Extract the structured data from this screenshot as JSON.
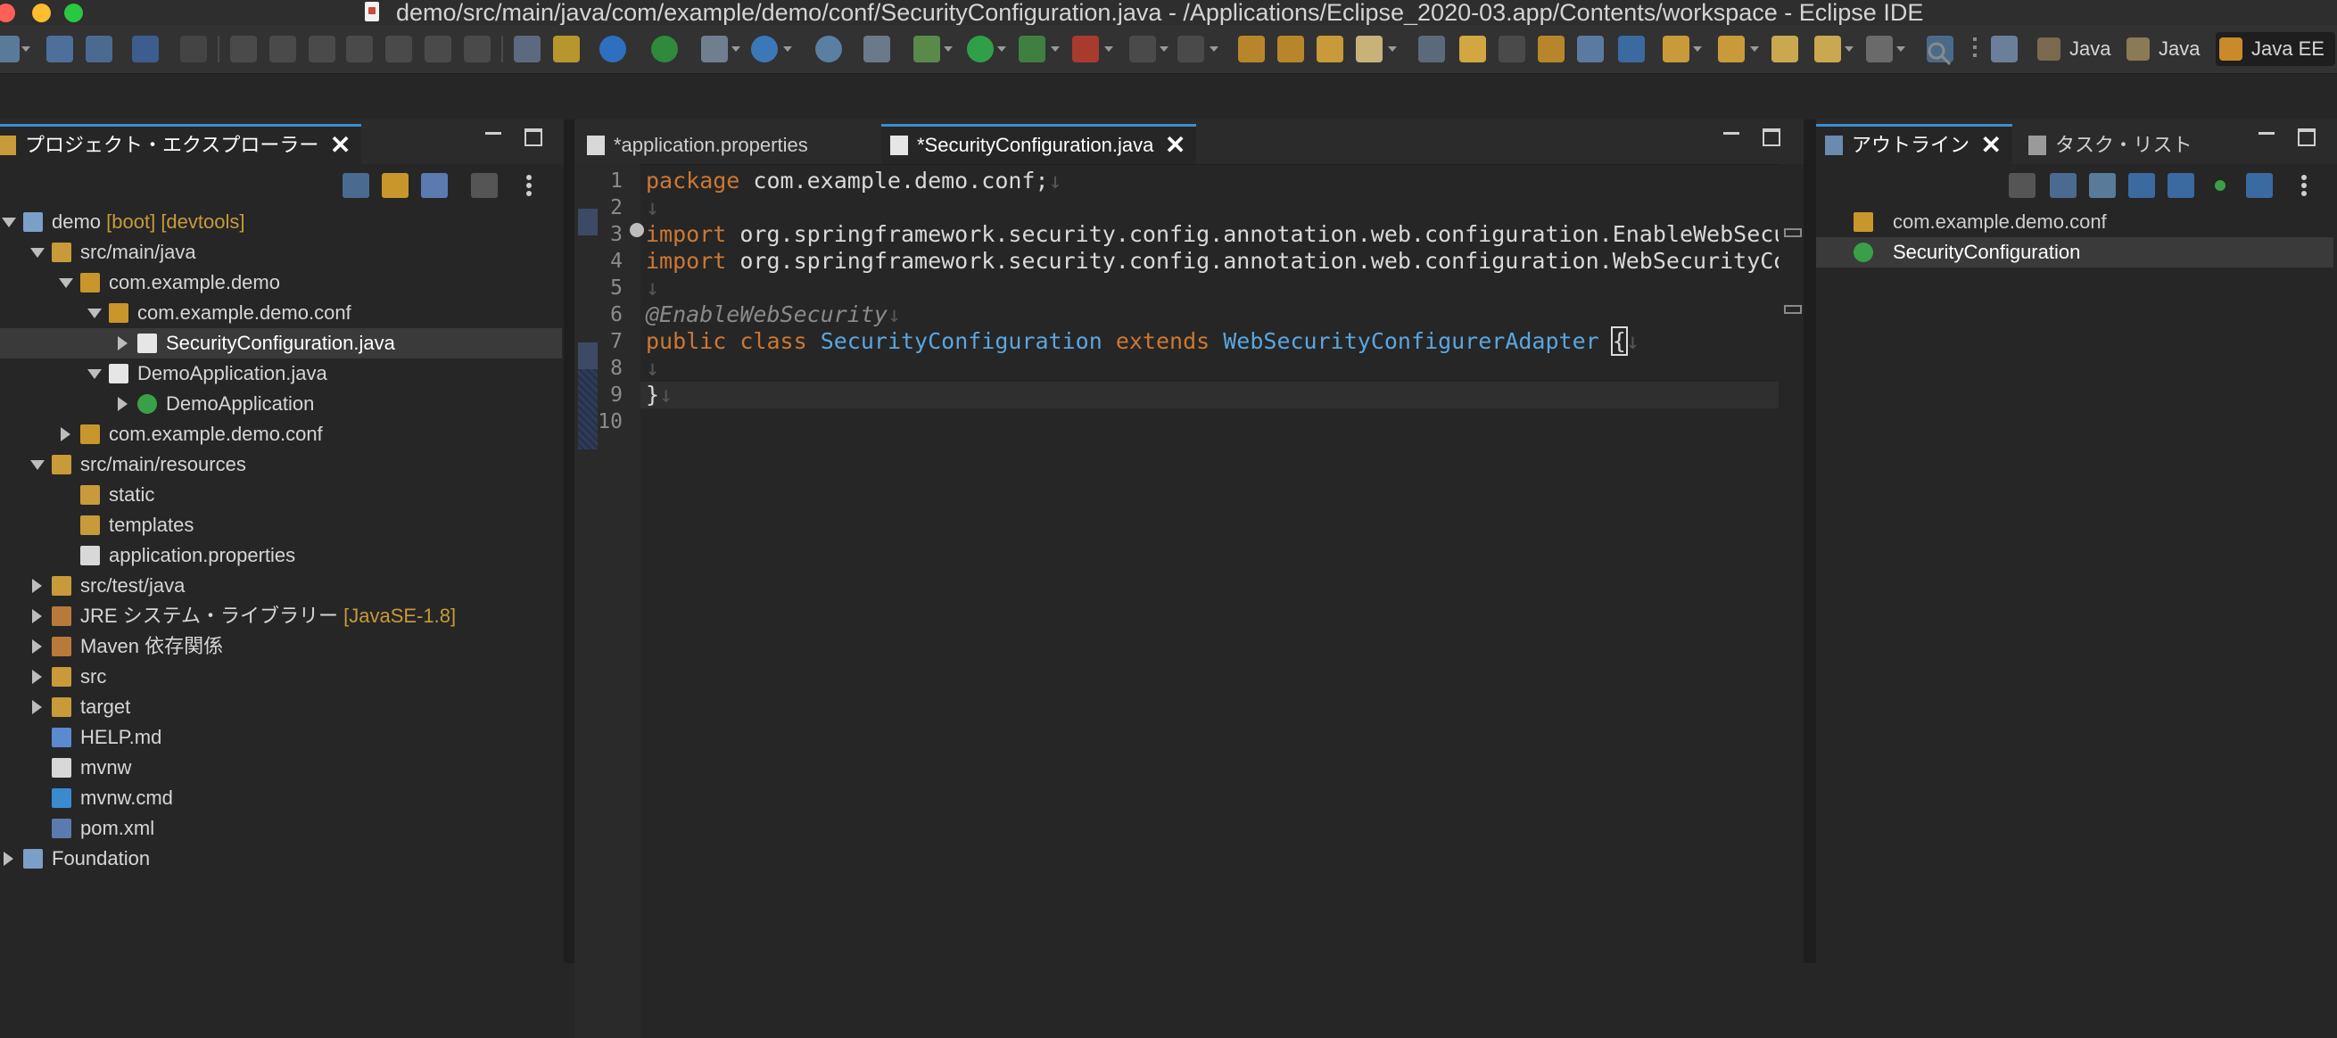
{
  "window": {
    "title": "demo/src/main/java/com/example/demo/conf/SecurityConfiguration.java - /Applications/Eclipse_2020-03.app/Contents/workspace - Eclipse IDE"
  },
  "perspectives": [
    {
      "label": "Java",
      "icon": "java-perspective-icon"
    },
    {
      "label": "Java",
      "icon": "java-browsing-perspective-icon"
    },
    {
      "label": "Java EE",
      "icon": "javaee-perspective-icon",
      "active": true
    }
  ],
  "explorer": {
    "tab_label": "プロジェクト・エクスプローラー",
    "tree": [
      {
        "label": "demo",
        "suffix": " [boot] [devtools]",
        "icon": "project-icon",
        "expanded": true
      },
      {
        "label": "src/main/java",
        "icon": "source-folder-icon",
        "expanded": true
      },
      {
        "label": "com.example.demo",
        "icon": "package-icon",
        "expanded": true
      },
      {
        "label": "com.example.demo.conf",
        "icon": "package-icon",
        "expanded": true
      },
      {
        "label": "SecurityConfiguration.java",
        "icon": "java-file-icon",
        "expanded": false,
        "selected": true
      },
      {
        "label": "DemoApplication.java",
        "icon": "java-file-icon",
        "expanded": true
      },
      {
        "label": "DemoApplication",
        "icon": "class-icon",
        "expanded": false
      },
      {
        "label": "com.example.demo.conf",
        "icon": "package-icon",
        "expanded": false
      },
      {
        "label": "src/main/resources",
        "icon": "source-folder-icon",
        "expanded": true
      },
      {
        "label": "static",
        "icon": "folder-icon"
      },
      {
        "label": "templates",
        "icon": "folder-icon"
      },
      {
        "label": "application.properties",
        "icon": "file-icon"
      },
      {
        "label": "src/test/java",
        "icon": "source-folder-icon",
        "expanded": false
      },
      {
        "label": "JRE システム・ライブラリー",
        "suffix": " [JavaSE-1.8]",
        "icon": "library-icon",
        "expanded": false
      },
      {
        "label": "Maven 依存関係",
        "icon": "library-icon",
        "expanded": false
      },
      {
        "label": "src",
        "icon": "folder-icon",
        "expanded": false
      },
      {
        "label": "target",
        "icon": "folder-icon",
        "expanded": false
      },
      {
        "label": "HELP.md",
        "icon": "markdown-file-icon"
      },
      {
        "label": "mvnw",
        "icon": "file-icon"
      },
      {
        "label": "mvnw.cmd",
        "icon": "vscode-file-icon"
      },
      {
        "label": "pom.xml",
        "icon": "maven-pom-icon"
      },
      {
        "label": "Foundation",
        "icon": "project-icon",
        "expanded": false
      }
    ]
  },
  "editor": {
    "tabs": [
      {
        "label": "*application.properties",
        "icon": "file-icon",
        "active": false
      },
      {
        "label": "*SecurityConfiguration.java",
        "icon": "java-file-icon",
        "active": true
      }
    ],
    "line_numbers": [
      "1",
      "2",
      "3",
      "4",
      "5",
      "6",
      "7",
      "8",
      "9",
      "10"
    ],
    "lines": {
      "l1_kw": "package",
      "l1_rest": " com.example.demo.conf;",
      "l3_kw": "import",
      "l3_rest": " org.springframework.security.config.annotation.web.configuration.EnableWebSecurity;",
      "l4_kw": "import",
      "l4_rest": " org.springframework.security.config.annotation.web.configuration.WebSecurityConfigurerAdapter;",
      "l6_an": "@EnableWebSecurity",
      "l7_kw1": "public class",
      "l7_ty1": "SecurityConfiguration",
      "l7_kw2": "extends",
      "l7_ty2": "WebSecurityConfigurerAdapter",
      "l7_brace": "{",
      "l9": "}",
      "ws": "↓"
    }
  },
  "outline": {
    "tabs": [
      {
        "label": "アウトライン",
        "icon": "outline-icon",
        "active": true
      },
      {
        "label": "タスク・リスト",
        "icon": "task-list-icon",
        "active": false
      }
    ],
    "items": [
      {
        "label": "com.example.demo.conf",
        "icon": "package-icon"
      },
      {
        "label": "SecurityConfiguration",
        "icon": "class-icon",
        "selected": true
      }
    ]
  },
  "close_glyph": "✕"
}
